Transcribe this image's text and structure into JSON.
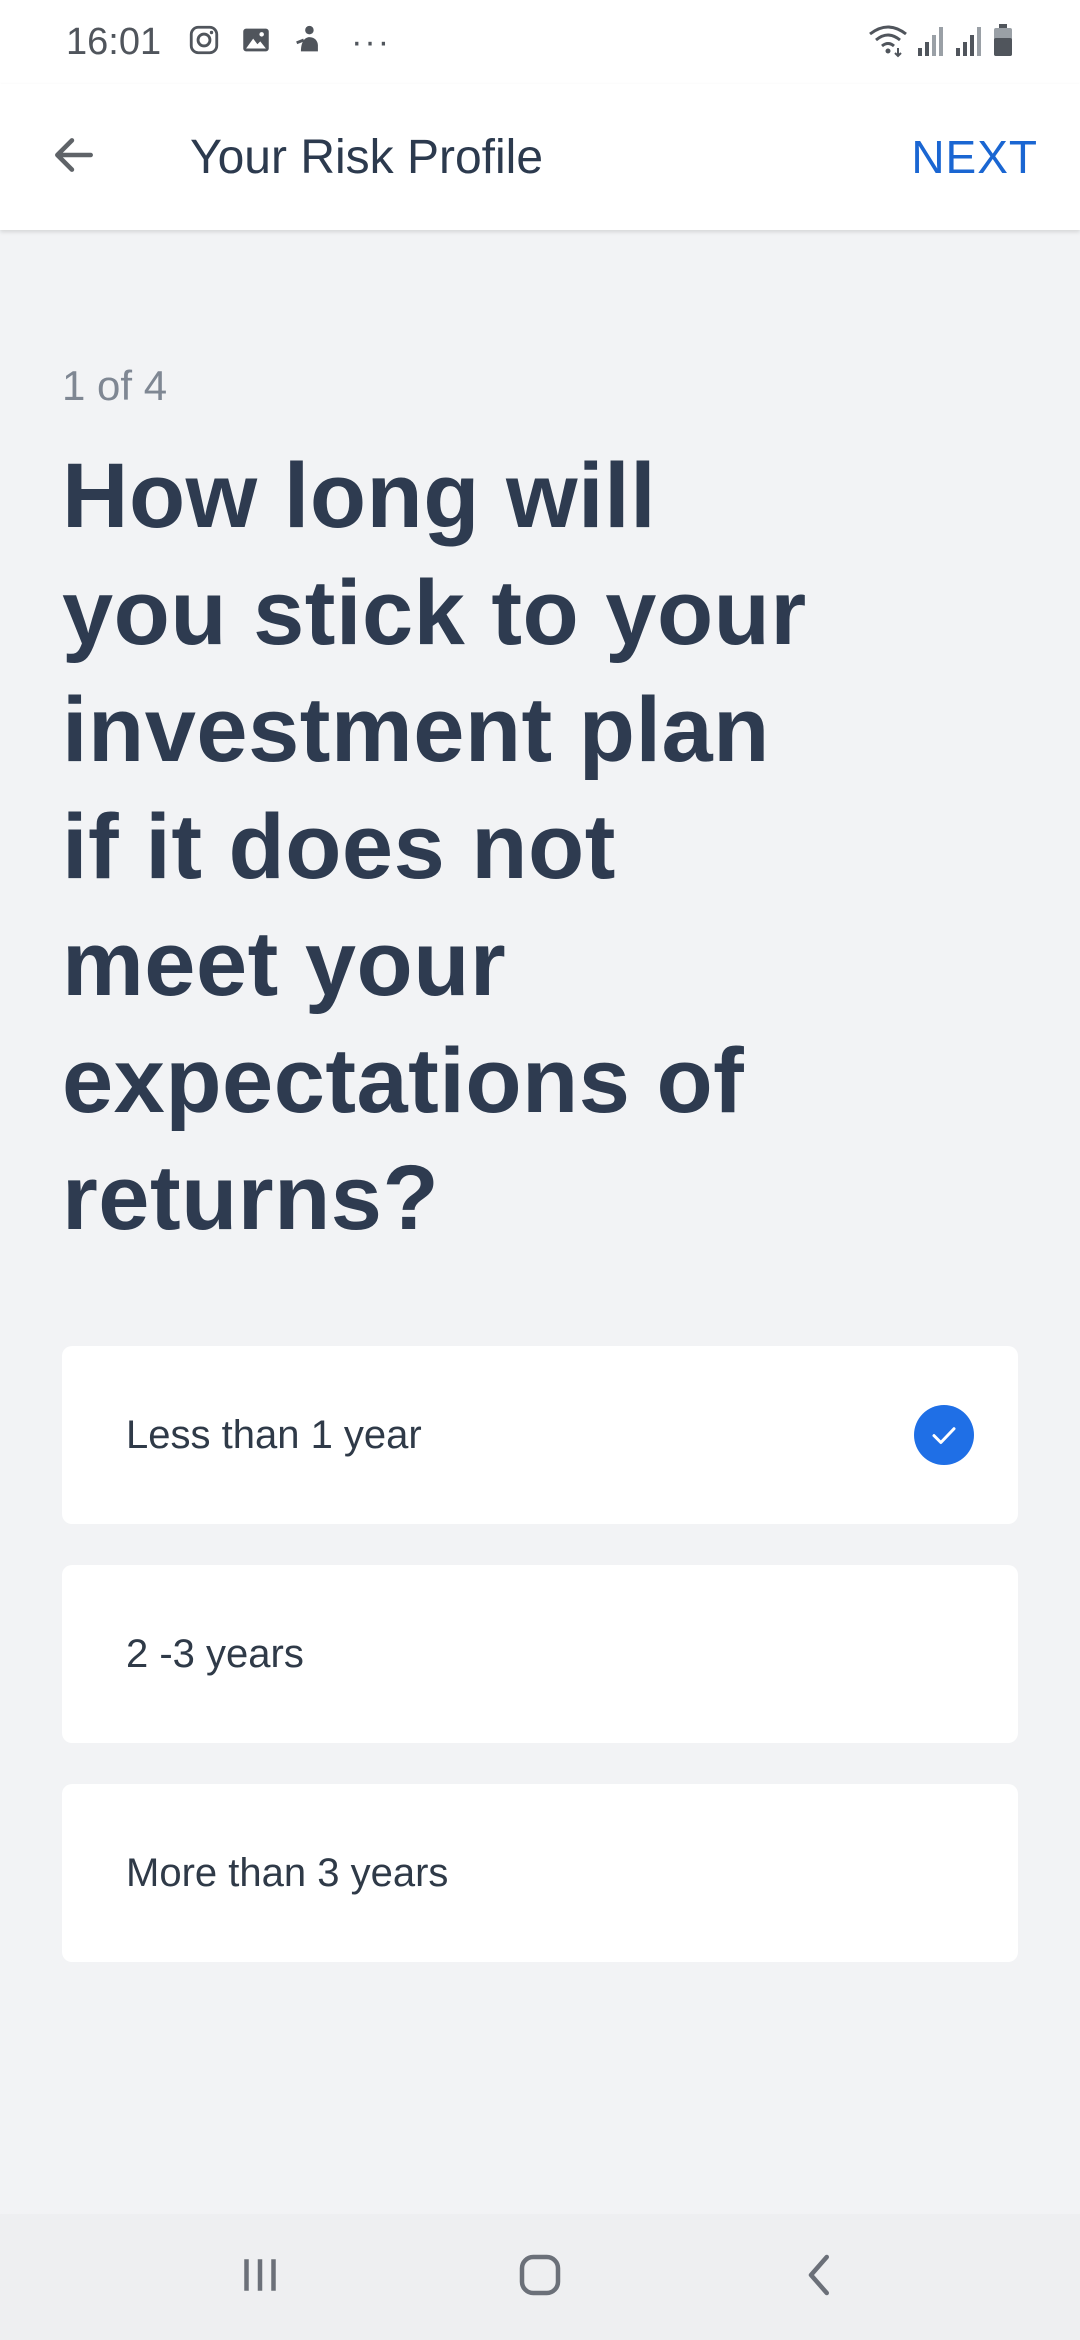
{
  "status_bar": {
    "time": "16:01",
    "left_icons": [
      "instagram-icon",
      "gallery-icon",
      "notification-icon"
    ],
    "more": "···",
    "right_icons": [
      "wifi-icon",
      "signal-icon",
      "signal-icon",
      "battery-icon"
    ]
  },
  "app_bar": {
    "title": "Your Risk Profile",
    "next_label": "NEXT",
    "accent_color": "#1a66d2"
  },
  "question": {
    "step": "1 of 4",
    "text": "How long will you stick to your investment plan if it does not meet your expectations of returns?"
  },
  "options": [
    {
      "label": "Less than 1 year",
      "selected": true
    },
    {
      "label": "2 -3 years",
      "selected": false
    },
    {
      "label": "More than 3 years",
      "selected": false
    }
  ],
  "nav_bar": {
    "buttons": [
      "recent-apps-icon",
      "home-icon",
      "back-icon"
    ]
  },
  "colors": {
    "background": "#f2f3f5",
    "heading": "#2e3b50",
    "check": "#1f6fe6"
  }
}
